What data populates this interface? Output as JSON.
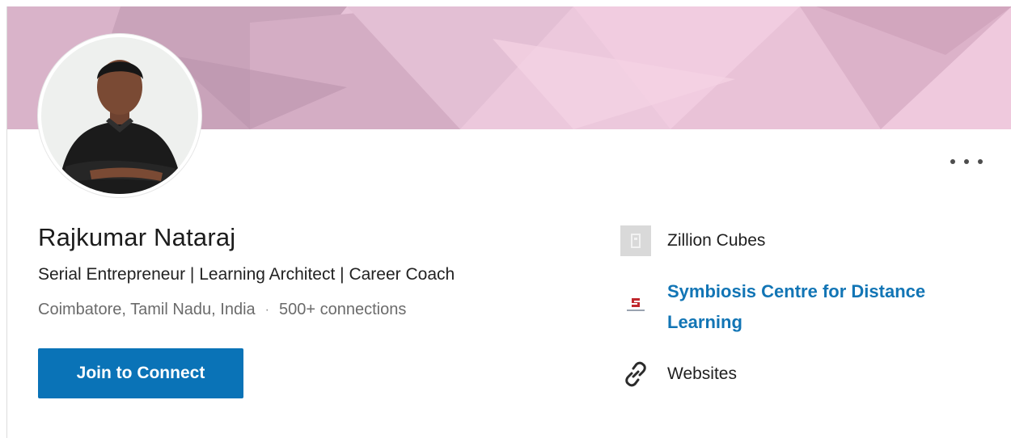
{
  "profile": {
    "name": "Rajkumar Nataraj",
    "headline": "Serial Entrepreneur | Learning Architect | Career Coach",
    "location": "Coimbatore, Tamil Nadu, India",
    "separator": "·",
    "connections": "500+ connections"
  },
  "actions": {
    "join_label": "Join to Connect"
  },
  "side": {
    "company": "Zillion Cubes",
    "school": "Symbiosis Centre for Distance Learning",
    "websites": "Websites"
  },
  "colors": {
    "accent": "#0a73b7",
    "link": "#1275b5",
    "banner": "#e9c6d9"
  },
  "icons": {
    "more": "more-horizontal-icon",
    "company": "company-logo-placeholder-icon",
    "school": "school-logo-icon",
    "link": "link-icon"
  }
}
